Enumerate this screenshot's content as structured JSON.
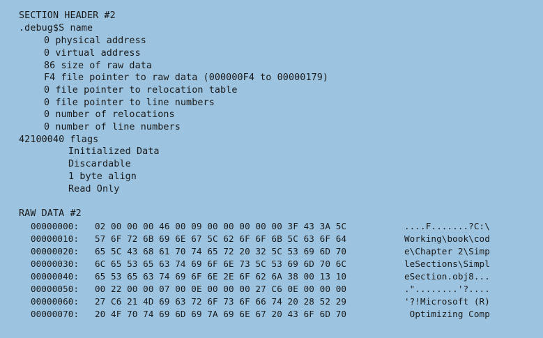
{
  "section_header": {
    "title": "SECTION HEADER #2",
    "name_line": ".debug$S name",
    "fields": [
      "0 physical address",
      "0 virtual address",
      "86 size of raw data",
      "F4 file pointer to raw data (000000F4 to 00000179)",
      "0 file pointer to relocation table",
      "0 file pointer to line numbers",
      "0 number of relocations",
      "0 number of line numbers"
    ],
    "flags_line": "42100040 flags",
    "flag_items": [
      "Initialized Data",
      "Discardable",
      "1 byte align",
      "Read Only"
    ]
  },
  "raw_data": {
    "title": "RAW DATA #2",
    "rows": [
      {
        "addr": "00000000:",
        "bytes": "02 00 00 00 46 00 09 00 00 00 00 00 3F 43 3A 5C",
        "ascii": "....F.......?C:\\"
      },
      {
        "addr": "00000010:",
        "bytes": "57 6F 72 6B 69 6E 67 5C 62 6F 6F 6B 5C 63 6F 64",
        "ascii": "Working\\book\\cod"
      },
      {
        "addr": "00000020:",
        "bytes": "65 5C 43 68 61 70 74 65 72 20 32 5C 53 69 6D 70",
        "ascii": "e\\Chapter 2\\Simp"
      },
      {
        "addr": "00000030:",
        "bytes": "6C 65 53 65 63 74 69 6F 6E 73 5C 53 69 6D 70 6C",
        "ascii": "leSections\\Simpl"
      },
      {
        "addr": "00000040:",
        "bytes": "65 53 65 63 74 69 6F 6E 2E 6F 62 6A 38 00 13 10",
        "ascii": "eSection.obj8..."
      },
      {
        "addr": "00000050:",
        "bytes": "00 22 00 00 07 00 0E 00 00 00 27 C6 0E 00 00 00",
        "ascii": ".\"........'?...."
      },
      {
        "addr": "00000060:",
        "bytes": "27 C6 21 4D 69 63 72 6F 73 6F 66 74 20 28 52 29",
        "ascii": "'?!Microsoft (R)"
      },
      {
        "addr": "00000070:",
        "bytes": "20 4F 70 74 69 6D 69 7A 69 6E 67 20 43 6F 6D 70",
        "ascii": " Optimizing Comp"
      }
    ]
  }
}
